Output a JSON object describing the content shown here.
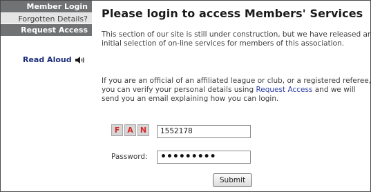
{
  "sidebar": {
    "items": [
      {
        "label": "Member Login"
      },
      {
        "label": "Forgotten Details?"
      },
      {
        "label": "Request Access"
      }
    ],
    "read_aloud": "Read Aloud"
  },
  "main": {
    "title": "Please login to access Members' Services",
    "para1": "This section of our site is still under construction, but we have released an initial selection of on-line services for members of this association.",
    "para2_before": "If you are an official of an affiliated league or club, or a registered referee, you can verify your personal details using ",
    "para2_link": "Request Access",
    "para2_after": " and we will send you an email explaining how you can login."
  },
  "form": {
    "fan_letters": [
      "F",
      "A",
      "N"
    ],
    "fan_value": "1552178",
    "password_label": "Password:",
    "password_value": "•••••••••",
    "submit_label": "Submit"
  },
  "colors": {
    "sidebar_dark": "#707274",
    "sidebar_light": "#e4e4e4",
    "link": "#2b3fa3",
    "fan_letter": "#d42a2a"
  },
  "icons": {
    "read_aloud": "speaker-icon"
  }
}
